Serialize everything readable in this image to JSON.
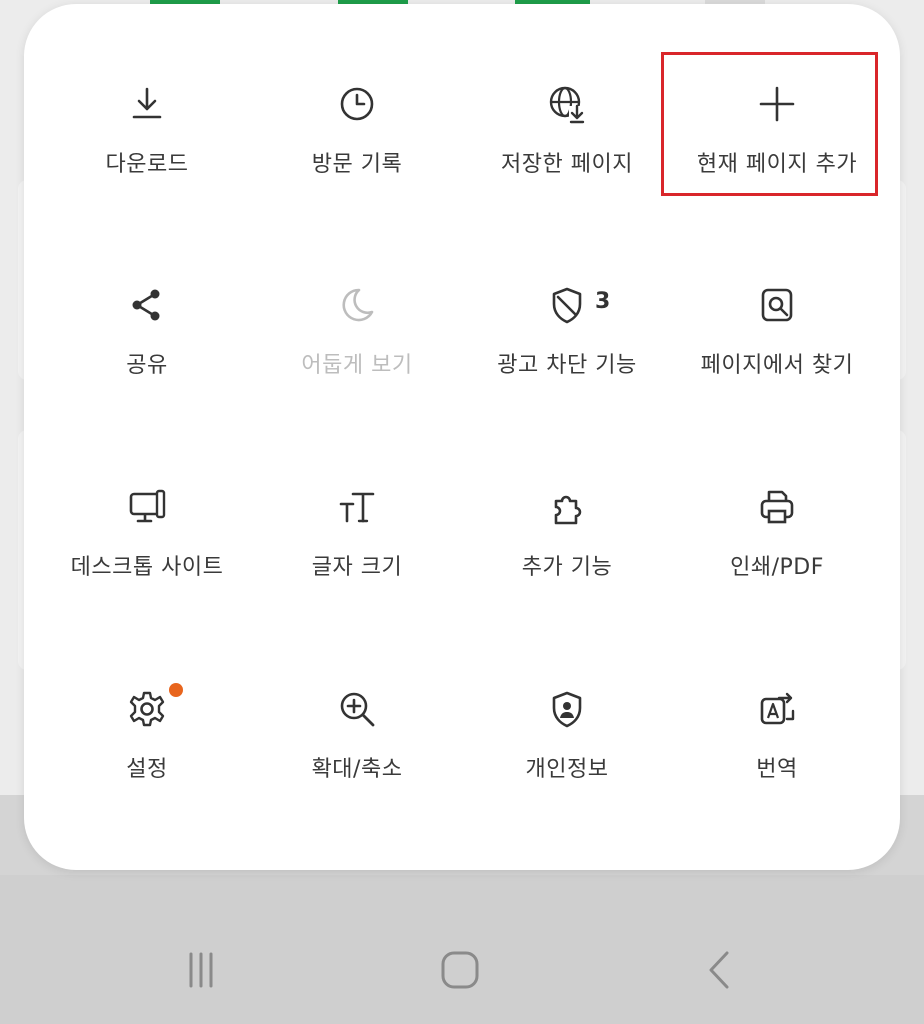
{
  "colors": {
    "panel_bg": "#ffffff",
    "icon_color": "#333333",
    "disabled_color": "#bdbdbd",
    "highlight_border": "#d9262a",
    "notification_dot": "#e8651d",
    "background": "#cfcfcf"
  },
  "menu": {
    "rows": [
      [
        {
          "label": "다운로드",
          "icon": "download-icon"
        },
        {
          "label": "방문 기록",
          "icon": "history-clock-icon"
        },
        {
          "label": "저장한 페이지",
          "icon": "saved-page-globe-icon"
        },
        {
          "label": "현재 페이지 추가",
          "icon": "plus-icon",
          "highlighted": true
        }
      ],
      [
        {
          "label": "공유",
          "icon": "share-icon"
        },
        {
          "label": "어둡게 보기",
          "icon": "moon-icon",
          "disabled": true
        },
        {
          "label": "광고 차단 기능",
          "icon": "shield-ad-block-icon",
          "badge": "3"
        },
        {
          "label": "페이지에서 찾기",
          "icon": "find-in-page-icon"
        }
      ],
      [
        {
          "label": "데스크톱 사이트",
          "icon": "desktop-icon"
        },
        {
          "label": "글자 크기",
          "icon": "text-size-icon"
        },
        {
          "label": "추가 기능",
          "icon": "puzzle-icon"
        },
        {
          "label": "인쇄/PDF",
          "icon": "printer-icon"
        }
      ],
      [
        {
          "label": "설정",
          "icon": "gear-icon",
          "notification": true
        },
        {
          "label": "확대/축소",
          "icon": "zoom-in-icon"
        },
        {
          "label": "개인정보",
          "icon": "privacy-shield-icon"
        },
        {
          "label": "번역",
          "icon": "translate-icon"
        }
      ]
    ]
  },
  "navbar": {
    "items": [
      {
        "icon": "recent-apps-icon"
      },
      {
        "icon": "home-icon"
      },
      {
        "icon": "back-icon"
      }
    ]
  }
}
